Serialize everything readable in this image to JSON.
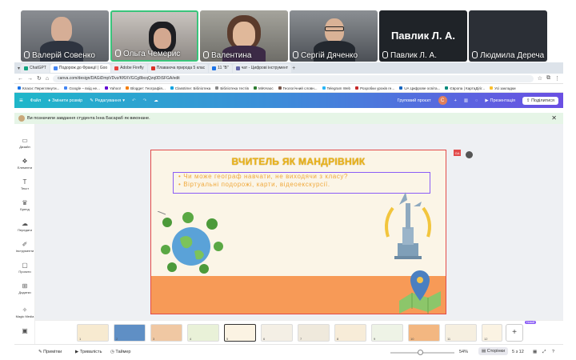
{
  "meeting": {
    "participants": [
      {
        "name": "Валерій Совенко"
      },
      {
        "name": "Ольга Чемерис"
      },
      {
        "name": "Валентина"
      },
      {
        "name": "Сергій Дяченко"
      },
      {
        "name": "Павлик Л. А."
      },
      {
        "name": "Людмила Дереча"
      }
    ],
    "featured_name": "Павлик Л. А."
  },
  "browser": {
    "tabs": [
      "ChatGPT",
      "Подорож до Франції | Goo",
      "Adobe Firefly",
      "Плаваюча природа 5 клас",
      "11 \"В\"",
      "чат - Цифрові інструмент"
    ],
    "url": "canva.com/design/DAGiDmpVDvz/Kf6XVGCg8bcqQzq0DiSFGA/edit",
    "bookmarks": [
      "Класи: Переглянути...",
      "Google – вхід не...",
      "Yahoo!",
      "Blogger: Географія...",
      "Classtime: Бібліотека",
      "Бібліотека тестів",
      "MiKHaoc",
      "Геологічний словн...",
      "Telegram Web",
      "Розробки уроків ге...",
      "UA Цифрове освіта...",
      "Європа | КартаДігіг...",
      "Усі закладки"
    ]
  },
  "canva": {
    "file": "Файл",
    "resize": "Змінити розмір",
    "editing": "Редагування",
    "group_project": "Груповий проєкт",
    "avatar_letter": "C",
    "present": "Презентація",
    "share": "Поділитися",
    "notification": "Ви позначили завдання студента Інна Басараб як виконане."
  },
  "sidebar": {
    "items": [
      "Дизайн",
      "Елементи",
      "Текст",
      "Бренд",
      "Передати",
      "Інструменти",
      "Проєкти",
      "Додатки",
      "Magic Media"
    ]
  },
  "slide": {
    "title": "ВЧИТЕЛЬ ЯК МАНДРІВНИК",
    "bullets": [
      "Чи може географ навчати, не виходячи з класу?",
      "Віртуальні подорожі, карти, відеоекскурсії."
    ],
    "badge": "GA"
  },
  "thumbnails": {
    "numbers": [
      "1",
      "2",
      "3",
      "4",
      "5",
      "6",
      "7",
      "8",
      "9",
      "10",
      "11",
      "12"
    ],
    "new_badge": "Новий"
  },
  "bottom": {
    "notes": "Примітки",
    "duration": "Тривалість",
    "timer": "Таймер",
    "zoom": "54%",
    "pages": "Сторінки",
    "page_count": "5 з 12"
  }
}
